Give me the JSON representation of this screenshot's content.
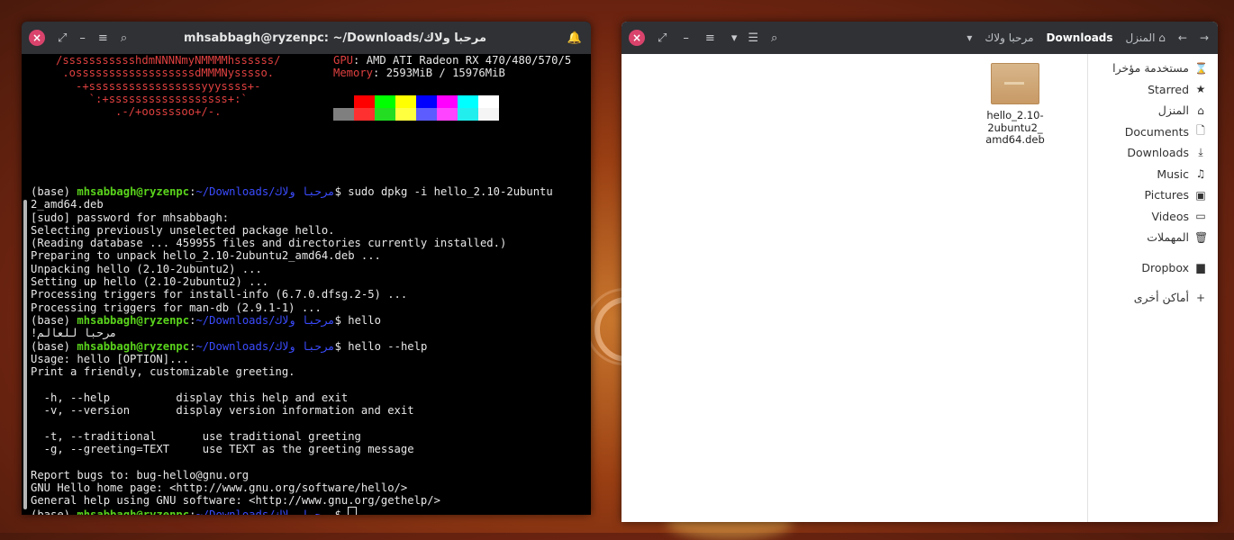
{
  "terminal": {
    "title": "mhsabbagh@ryzenpc: ~/Downloads/مرحبا ولاك",
    "icons": {
      "close": "×",
      "resize": "⤢",
      "minimize": "–",
      "menu": "≡",
      "search": "⌕",
      "bell": "🔔"
    },
    "neofetch": {
      "art": [
        "/ssssssssssshdmNNNNmyNMMMMhssssss/",
        " .ossssssssssssssssssdMMMNysssso.",
        "   -+sssssssssssssssssyyyssss+-",
        "     `:+ssssssssssssssssss+:`",
        "         .-/+oossssoo+/-."
      ],
      "gpu_label": "GPU",
      "gpu_value": ": AMD ATI Radeon RX 470/480/570/5",
      "mem_label": "Memory",
      "mem_value": ": 2593MiB / 15976MiB",
      "palette": [
        "#000000",
        "#ff0000",
        "#00ff00",
        "#ffff00",
        "#0000ff",
        "#ff00ff",
        "#00ffff",
        "#ffffff",
        "#7f7f7f",
        "#ff3030",
        "#22dd22",
        "#ffff40",
        "#5c5cff",
        "#ff44ff",
        "#22eeee",
        "#f5f5f5"
      ]
    },
    "prompt": {
      "env": "(base) ",
      "user": "mhsabbagh@ryzenpc",
      "colon": ":",
      "path": "~/Downloads/مرحبا ولاك",
      "dollar": "$"
    },
    "cmd1": " sudo dpkg -i hello_2.10-2ubuntu",
    "cmd1_wrap": "2_amd64.deb",
    "out1": [
      "[sudo] password for mhsabbagh:",
      "Selecting previously unselected package hello.",
      "(Reading database ... 459955 files and directories currently installed.)",
      "Preparing to unpack hello_2.10-2ubuntu2_amd64.deb ...",
      "Unpacking hello (2.10-2ubuntu2) ...",
      "Setting up hello (2.10-2ubuntu2) ...",
      "Processing triggers for install-info (6.7.0.dfsg.2-5) ...",
      "Processing triggers for man-db (2.9.1-1) ..."
    ],
    "cmd2": " hello",
    "out2": "!مرحبا للعالم",
    "cmd3": " hello --help",
    "out3": [
      "Usage: hello [OPTION]...",
      "Print a friendly, customizable greeting.",
      "",
      "  -h, --help          display this help and exit",
      "  -v, --version       display version information and exit",
      "",
      "  -t, --traditional       use traditional greeting",
      "  -g, --greeting=TEXT     use TEXT as the greeting message",
      "",
      "Report bugs to: bug-hello@gnu.org",
      "GNU Hello home page: <http://www.gnu.org/software/hello/>",
      "General help using GNU software: <http://www.gnu.org/gethelp/>"
    ]
  },
  "filemanager": {
    "icons": {
      "close": "×",
      "resize": "⤢",
      "minimize": "–",
      "menu": "≡",
      "sort": "▾",
      "view": "☰",
      "search": "⌕",
      "forward": "→",
      "back": "←",
      "home": "⌂",
      "dropdown": "▾"
    },
    "breadcrumbs": {
      "current_folder": "مرحبا ولاك",
      "downloads": "Downloads",
      "home": "المنزل"
    },
    "sidebar": [
      {
        "label": "مستخدمة مؤخرا",
        "icon": "⌛"
      },
      {
        "label": "Starred",
        "icon": "★"
      },
      {
        "label": "المنزل",
        "icon": "⌂"
      },
      {
        "label": "Documents",
        "icon": "🗋"
      },
      {
        "label": "Downloads",
        "icon": "⤓"
      },
      {
        "label": "Music",
        "icon": "♫"
      },
      {
        "label": "Pictures",
        "icon": "▣"
      },
      {
        "label": "Videos",
        "icon": "▭"
      },
      {
        "label": "المهملات",
        "icon": "🗑"
      },
      {
        "label": "Dropbox",
        "icon": "▆"
      },
      {
        "label": "أماكن أخرى",
        "icon": "+"
      }
    ],
    "file": {
      "name": "hello_2.10-\n2ubuntu2_\namd64.deb"
    }
  }
}
